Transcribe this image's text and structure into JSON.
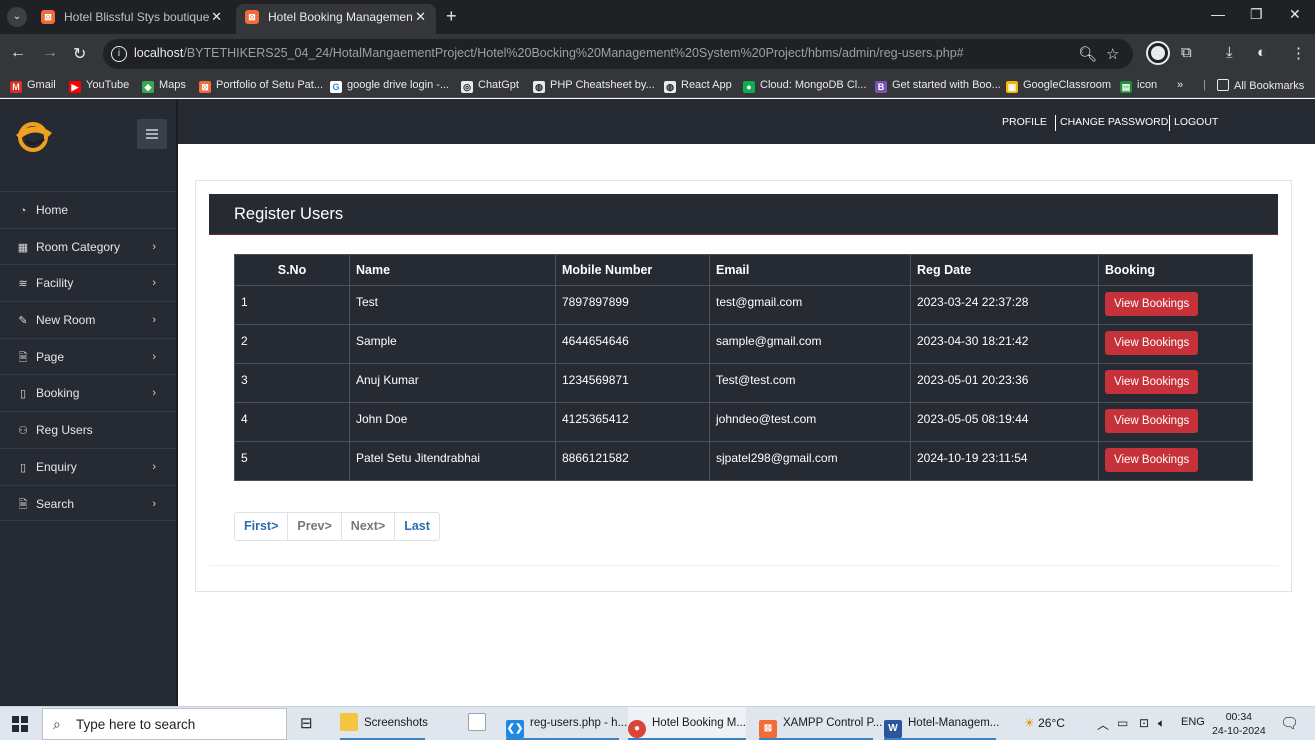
{
  "browser": {
    "tabs": [
      {
        "title": "Hotel Blissful Stys boutique | Ho"
      },
      {
        "title": "Hotel Booking Management Sy"
      }
    ],
    "url_host": "localhost",
    "url_path": "/BYTETHIKERS25_04_24/HotalMangaementProject/Hotel%20Bocking%20Management%20System%20Project/hbms/admin/reg-users.php#",
    "bookmarks": [
      "Gmail",
      "YouTube",
      "Maps",
      "Portfolio of Setu Pat...",
      "google drive login -...",
      "ChatGpt",
      "PHP Cheatsheet by...",
      "React App",
      "Cloud: MongoDB Cl...",
      "Get started with Boo...",
      "GoogleClassroom",
      "icon",
      "All Bookmarks"
    ]
  },
  "topnav": {
    "profile": "PROFILE",
    "change_password": "CHANGE PASSWORD",
    "logout": "LOGOUT"
  },
  "sidebar": {
    "items": [
      {
        "label": "Home",
        "icon": "dashboard-icon",
        "has_submenu": false
      },
      {
        "label": "Room Category",
        "icon": "table-icon",
        "has_submenu": true
      },
      {
        "label": "Facility",
        "icon": "layers-icon",
        "has_submenu": true
      },
      {
        "label": "New Room",
        "icon": "pencil-icon",
        "has_submenu": true
      },
      {
        "label": "Page",
        "icon": "file-icon",
        "has_submenu": true
      },
      {
        "label": "Booking",
        "icon": "tablet-icon",
        "has_submenu": true
      },
      {
        "label": "Reg Users",
        "icon": "users-icon",
        "has_submenu": false
      },
      {
        "label": "Enquiry",
        "icon": "tablet-icon",
        "has_submenu": true
      },
      {
        "label": "Search",
        "icon": "file-icon",
        "has_submenu": true
      }
    ]
  },
  "page": {
    "title": "Register Users",
    "columns": [
      "S.No",
      "Name",
      "Mobile Number",
      "Email",
      "Reg Date",
      "Booking"
    ],
    "rows": [
      {
        "sno": "1",
        "name": "Test",
        "mobile": "7897897899",
        "email": "test@gmail.com",
        "reg_date": "2023-03-24 22:37:28",
        "action": "View Bookings"
      },
      {
        "sno": "2",
        "name": "Sample",
        "mobile": "4644654646",
        "email": "sample@gmail.com",
        "reg_date": "2023-04-30 18:21:42",
        "action": "View Bookings"
      },
      {
        "sno": "3",
        "name": "Anuj Kumar",
        "mobile": "1234569871",
        "email": "Test@test.com",
        "reg_date": "2023-05-01 20:23:36",
        "action": "View Bookings"
      },
      {
        "sno": "4",
        "name": "John Doe",
        "mobile": "4125365412",
        "email": "johndeo@test.com",
        "reg_date": "2023-05-05 08:19:44",
        "action": "View Bookings"
      },
      {
        "sno": "5",
        "name": "Patel Setu Jitendrabhai",
        "mobile": "8866121582",
        "email": "sjpatel298@gmail.com",
        "reg_date": "2024-10-19 23:11:54",
        "action": "View Bookings"
      }
    ],
    "pagination": {
      "first": "First>",
      "prev": "Prev>",
      "next": "Next>",
      "last": "Last"
    }
  },
  "taskbar": {
    "search_placeholder": "Type here to search",
    "apps": [
      {
        "label": "Screenshots"
      },
      {
        "label": "reg-users.php - h..."
      },
      {
        "label": "Hotel Booking M..."
      },
      {
        "label": "XAMPP Control P..."
      },
      {
        "label": "Hotel-Managem..."
      }
    ],
    "weather": "26°C",
    "language": "ENG",
    "time": "00:34",
    "date": "24-10-2024"
  },
  "colors": {
    "sidebar_bg": "#262a33",
    "action_red": "#c7313a",
    "pager_blue": "#2b6cb0"
  }
}
